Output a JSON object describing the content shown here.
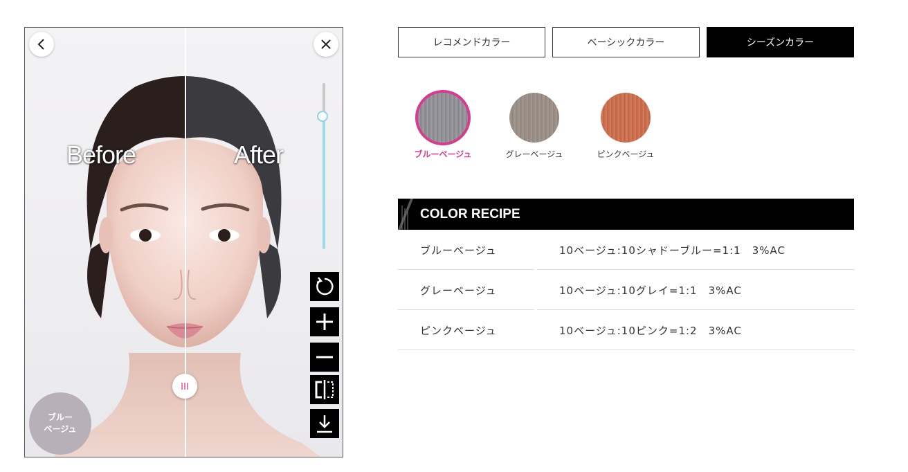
{
  "preview": {
    "before_label": "Before",
    "after_label": "After",
    "current_color_line1": "ブルー",
    "current_color_line2": "ベージュ",
    "intensity_level": 0.8,
    "tools": [
      "reset-icon",
      "zoom-in-icon",
      "zoom-out-icon",
      "compare-icon",
      "download-icon"
    ]
  },
  "tabs": [
    {
      "label": "レコメンドカラー",
      "active": false
    },
    {
      "label": "ベーシックカラー",
      "active": false
    },
    {
      "label": "シーズンカラー",
      "active": true
    }
  ],
  "swatches": [
    {
      "label": "ブルーベージュ",
      "color": "#8e8f94",
      "selected": true
    },
    {
      "label": "グレーベージュ",
      "color": "#9b9088",
      "selected": false
    },
    {
      "label": "ピンクベージュ",
      "color": "#c9704f",
      "selected": false
    }
  ],
  "recipe": {
    "title": "COLOR RECIPE",
    "rows": [
      {
        "name": "ブルーベージュ",
        "formula": "10ベージュ:10シャドーブルー=1:1　3%AC"
      },
      {
        "name": "グレーベージュ",
        "formula": "10ベージュ:10グレイ=1:1　3%AC"
      },
      {
        "name": "ピンクベージュ",
        "formula": "10ベージュ:10ピンク=1:2　3%AC"
      }
    ]
  },
  "colors": {
    "accent_pink": "#d63b8f",
    "slider": "#9edbe8"
  }
}
